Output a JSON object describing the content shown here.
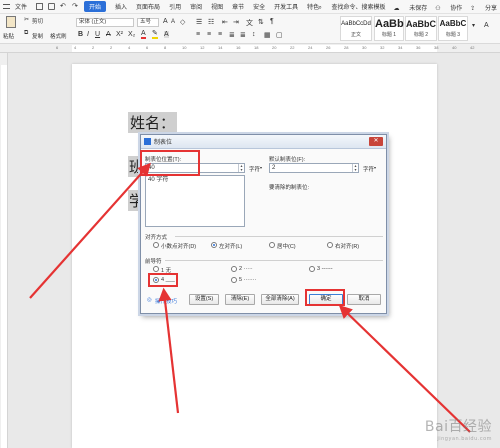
{
  "menubar": {
    "file": "文件",
    "tabs": [
      "开始",
      "插入",
      "页面布局",
      "引用",
      "审阅",
      "视图",
      "章节",
      "安全",
      "开发工具",
      "特色"
    ],
    "search": "查找命令、搜索模板",
    "cloud": "未保存",
    "collab": "协作",
    "share": "分享"
  },
  "ribbon": {
    "paste": "粘贴",
    "cut": "剪切",
    "copy": "复制",
    "format_painter": "格式刷",
    "font_name": "宋体 (正文)",
    "font_size": "五号",
    "styles": [
      {
        "preview": "AaBbCcDd",
        "name": "正文"
      },
      {
        "preview": "AaBb",
        "name": "标题 1"
      },
      {
        "preview": "AaBbC",
        "name": "标题 2"
      },
      {
        "preview": "AaBbC",
        "name": "标题 3"
      }
    ]
  },
  "ruler_ticks": [
    "6",
    "4",
    "2",
    "2",
    "4",
    "6",
    "8",
    "10",
    "12",
    "14",
    "16",
    "18",
    "20",
    "22",
    "24",
    "26",
    "28",
    "30",
    "32",
    "34",
    "36",
    "38",
    "40",
    "42"
  ],
  "document": {
    "line1": "姓名：",
    "line2": "班",
    "line3": "学"
  },
  "dialog": {
    "title": "制表位",
    "tab_position_label": "制表位位置(T):",
    "tab_position_value": "40",
    "tab_position_unit": "字符",
    "tab_list": [
      "40 字符"
    ],
    "default_tab_label": "默认制表位(F):",
    "default_tab_value": "2",
    "default_tab_unit": "字符",
    "to_clear_label": "要清除的制表位:",
    "alignment_title": "对齐方式",
    "alignment": [
      {
        "label": "小数点对齐(D)",
        "selected": false
      },
      {
        "label": "左对齐(L)",
        "selected": true
      },
      {
        "label": "居中(C)",
        "selected": false
      },
      {
        "label": "右对齐(R)",
        "selected": false
      }
    ],
    "leader_title": "前导符",
    "leaders": [
      {
        "label": "1 无",
        "selected": false
      },
      {
        "label": "2 ·····",
        "selected": false
      },
      {
        "label": "3 ------",
        "selected": false
      },
      {
        "label": "4 ___",
        "selected": true
      },
      {
        "label": "5 ·······",
        "selected": false
      }
    ],
    "tips": "操作技巧",
    "btn_set": "设置(S)",
    "btn_clear": "清除(E)",
    "btn_clear_all": "全部清除(A)",
    "btn_ok": "确定",
    "btn_cancel": "取消"
  },
  "watermark": {
    "text": "Bai百经验",
    "sub": "jingyan.baidu.com"
  },
  "colors": {
    "accent": "#2b6fd8",
    "highlight": "#e53333"
  }
}
